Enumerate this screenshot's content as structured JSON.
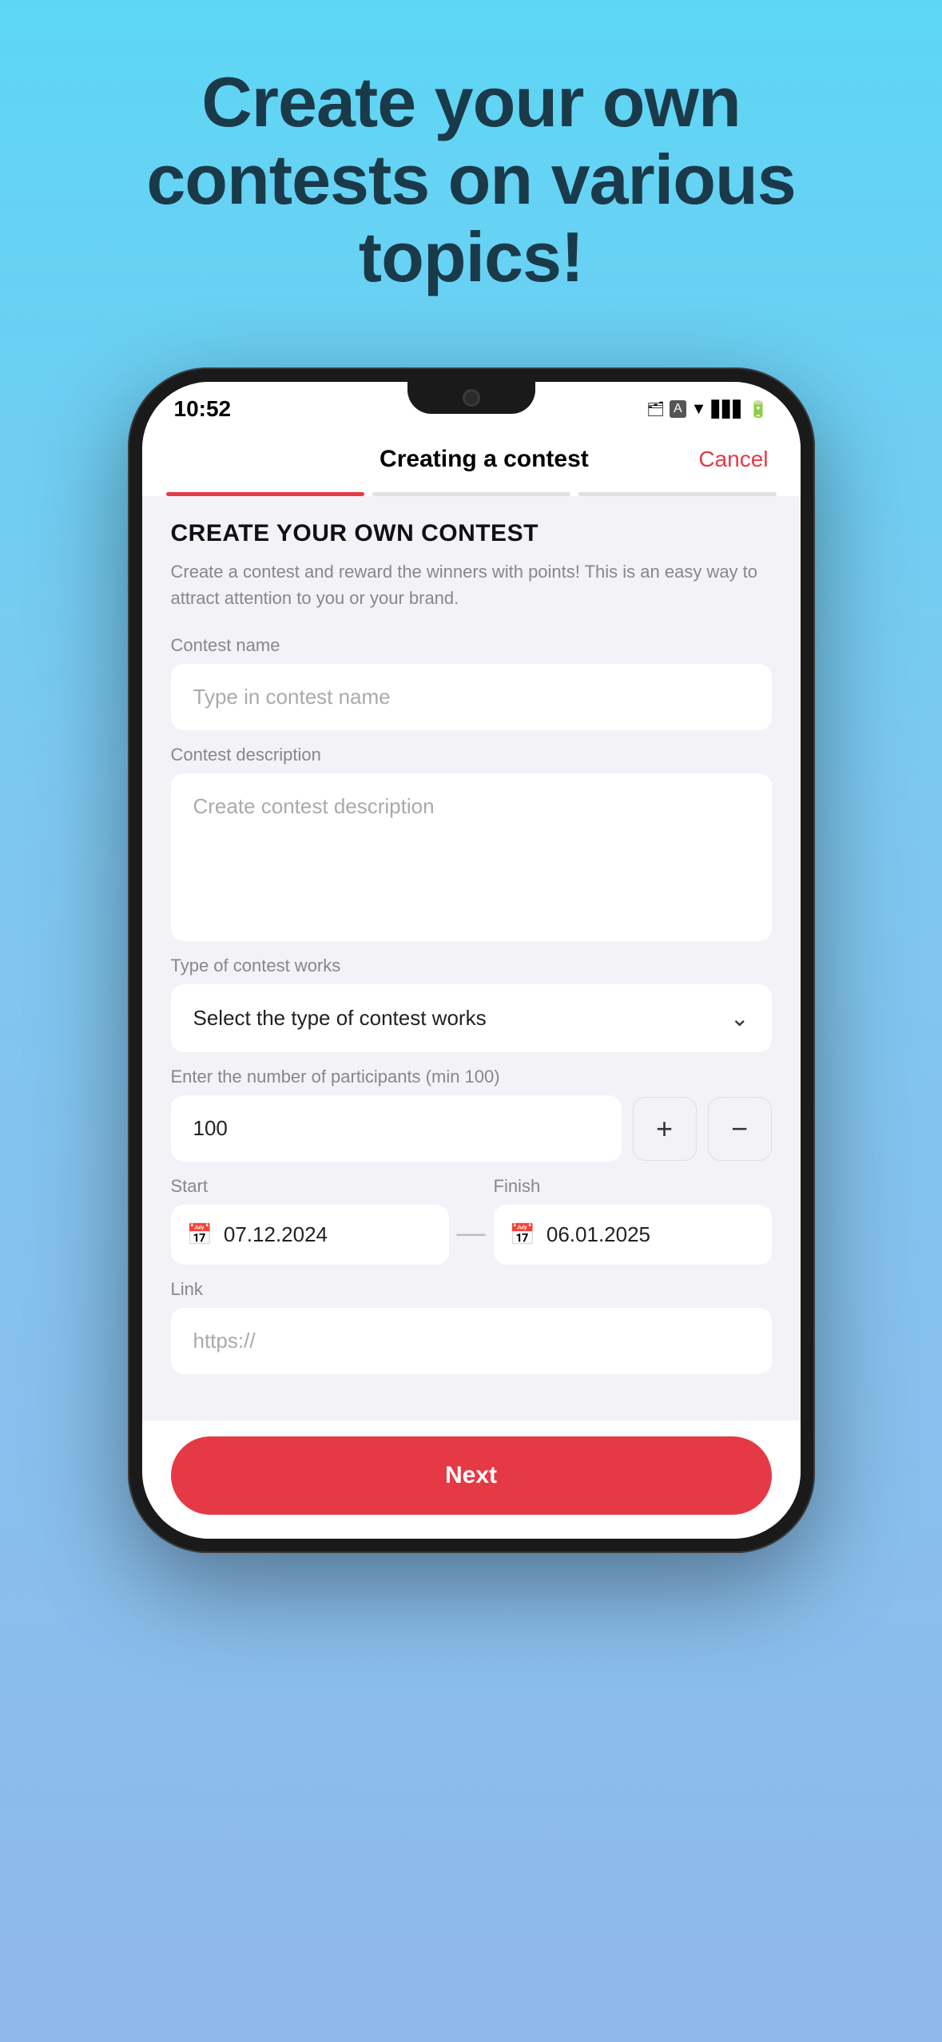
{
  "hero": {
    "title": "Create your own contests on various topics!"
  },
  "status_bar": {
    "time": "10:52",
    "icons": [
      "wifi",
      "signal",
      "battery"
    ]
  },
  "header": {
    "title": "Creating a contest",
    "cancel_label": "Cancel"
  },
  "progress": {
    "segments": [
      "active",
      "inactive",
      "inactive"
    ]
  },
  "form": {
    "section_title": "CREATE YOUR OWN CONTEST",
    "section_desc": "Create a contest and reward the winners with points! This is an easy way to attract attention to you or your brand.",
    "contest_name_label": "Contest name",
    "contest_name_placeholder": "Type in contest name",
    "contest_desc_label": "Contest description",
    "contest_desc_placeholder": "Create contest description",
    "type_label": "Type of contest works",
    "type_placeholder": "Select the type of contest works",
    "participants_label": "Enter the number of participants (min 100)",
    "participants_value": "100",
    "plus_btn": "+",
    "minus_btn": "−",
    "start_label": "Start",
    "finish_label": "Finish",
    "start_date": "07.12.2024",
    "finish_date": "06.01.2025",
    "link_label": "Link",
    "link_placeholder": "https://",
    "submit_label": "Next"
  }
}
